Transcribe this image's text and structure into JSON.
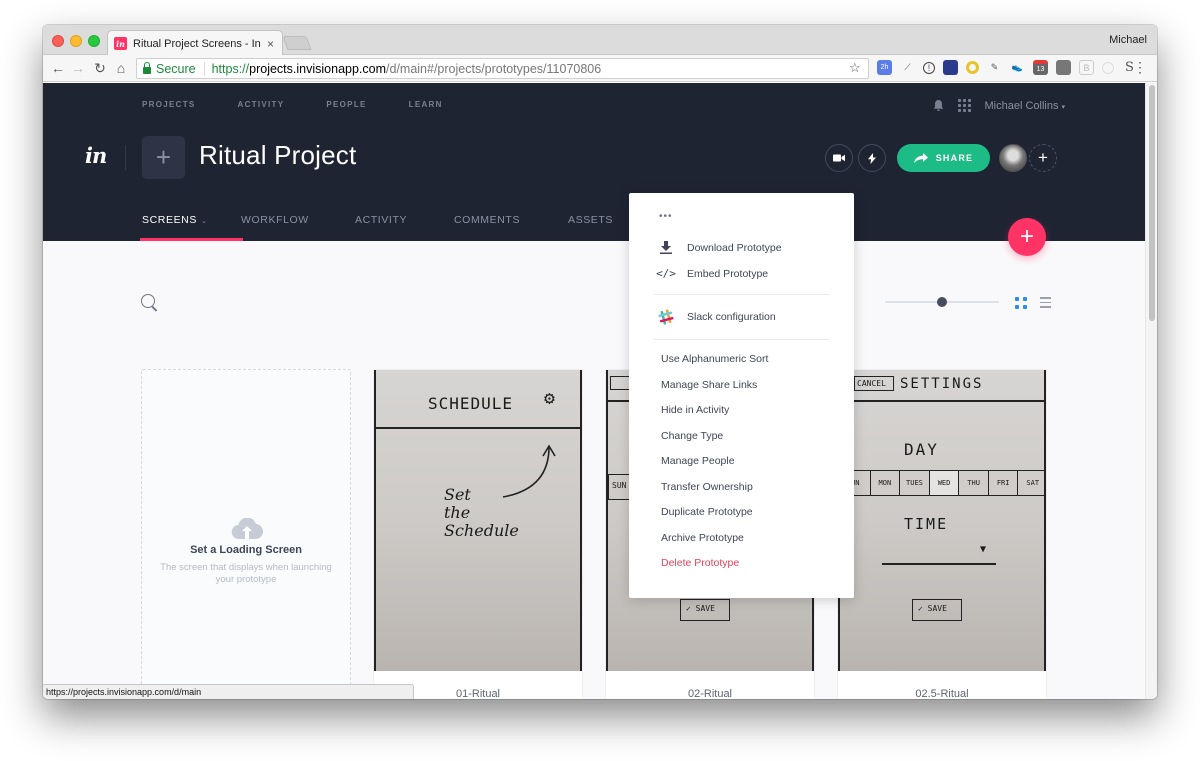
{
  "browser": {
    "tab_title": "Ritual Project Screens - InVisio",
    "profile_name": "Michael",
    "omnibox": {
      "secure_label": "Secure",
      "url_scheme": "https://",
      "url_host": "projects.invisionapp.com",
      "url_path": "/d/main#/projects/prototypes/11070806"
    },
    "status_url": "https://projects.invisionapp.com/d/main",
    "extensions": [
      "calendar-2h",
      "eyedropper",
      "1password",
      "graph",
      "lens",
      "pen",
      "sneaker",
      "cal-13",
      "clip",
      "b",
      "circle",
      "s"
    ]
  },
  "topnav": {
    "items": [
      "PROJECTS",
      "ACTIVITY",
      "PEOPLE",
      "LEARN"
    ],
    "user_name": "Michael Collins"
  },
  "project": {
    "title": "Ritual Project",
    "share_label": "SHARE"
  },
  "tabs": [
    {
      "label": "SCREENS",
      "active": true
    },
    {
      "label": "WORKFLOW",
      "active": false
    },
    {
      "label": "ACTIVITY",
      "active": false
    },
    {
      "label": "COMMENTS",
      "active": false
    },
    {
      "label": "ASSETS",
      "active": false
    }
  ],
  "toolbar": {
    "zoom_level": 0.5,
    "view_mode": "grid"
  },
  "loading_card": {
    "title": "Set a Loading Screen",
    "subtitle": "The screen that displays when launching your prototype"
  },
  "screens": [
    {
      "label": "01-Ritual",
      "sketch_title": "SCHEDULE",
      "note": [
        "Set",
        "the",
        "Schedule"
      ]
    },
    {
      "label": "02-Ritual",
      "sketch_day": "SUN",
      "save": "SAVE"
    },
    {
      "label": "02.5-Ritual",
      "cancel": "CANCEL",
      "sketch_title": "SETTINGS",
      "day": "DAY",
      "days": [
        "UN",
        "MON",
        "TUES",
        "WED",
        "THU",
        "FRI",
        "SAT"
      ],
      "time": "TIME",
      "save": "SAVE"
    }
  ],
  "dropdown": {
    "more_label": "•••",
    "top_items": [
      {
        "label": "Download Prototype",
        "icon": "download-icon"
      },
      {
        "label": "Embed Prototype",
        "icon": "code-icon"
      }
    ],
    "slack_item": {
      "label": "Slack configuration",
      "icon": "slack-icon"
    },
    "items": [
      "Use Alphanumeric Sort",
      "Manage Share Links",
      "Hide in Activity",
      "Change Type",
      "Manage People",
      "Transfer Ownership",
      "Duplicate Prototype",
      "Archive Prototype"
    ],
    "danger_item": "Delete Prototype",
    "danger_color": "#e0445e"
  },
  "colors": {
    "header_bg": "#1f2433",
    "accent_pink": "#ff3366",
    "share_green": "#1dbb86",
    "view_active_blue": "#2b8be8"
  }
}
